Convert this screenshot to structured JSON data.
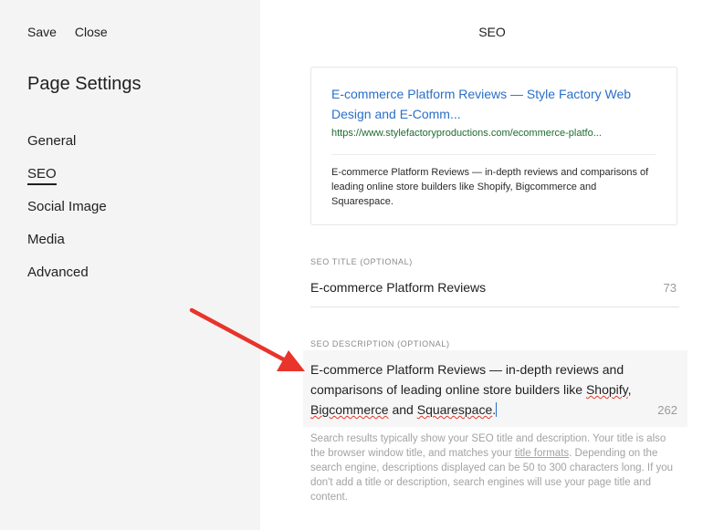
{
  "sidebar": {
    "actions": {
      "save": "Save",
      "close": "Close"
    },
    "title": "Page Settings",
    "items": [
      {
        "label": "General"
      },
      {
        "label": "SEO"
      },
      {
        "label": "Social Image"
      },
      {
        "label": "Media"
      },
      {
        "label": "Advanced"
      }
    ],
    "active_item": "SEO"
  },
  "main": {
    "title": "SEO",
    "preview": {
      "title": "E-commerce Platform Reviews — Style Factory Web Design and E-Comm...",
      "url": "https://www.stylefactoryproductions.com/ecommerce-platfo...",
      "description": "E-commerce Platform Reviews — in-depth reviews and comparisons of leading online store builders like Shopify, Bigcommerce and Squarespace."
    },
    "seo_title": {
      "label": "SEO TITLE (OPTIONAL)",
      "value": "E-commerce Platform Reviews",
      "count": "73"
    },
    "seo_description": {
      "label": "SEO DESCRIPTION (OPTIONAL)",
      "value_line1": "E-commerce Platform Reviews — in-depth reviews and comparisons of leading online store builders like",
      "value_shopify": "Shopify",
      "value_sep1": ", ",
      "value_bigcommerce": "Bigcommerce",
      "value_sep2": " and ",
      "value_squarespace": "Squarespace",
      "value_end": ".",
      "count": "262"
    },
    "help": {
      "text_before": "Search results typically show your SEO title and description. Your title is also the browser window title, and matches your ",
      "link": "title formats",
      "text_after": ". Depending on the search engine, descriptions displayed can be 50 to 300 characters long. If you don't add a title or description, search engines will use your page title and content."
    }
  },
  "colors": {
    "sidebar_bg": "#f4f4f4",
    "link_blue": "#2a6fc9",
    "url_green": "#1e6b34",
    "annotation_arrow": "#e8342a"
  },
  "annotation": {
    "icon": "red-arrow-icon"
  }
}
